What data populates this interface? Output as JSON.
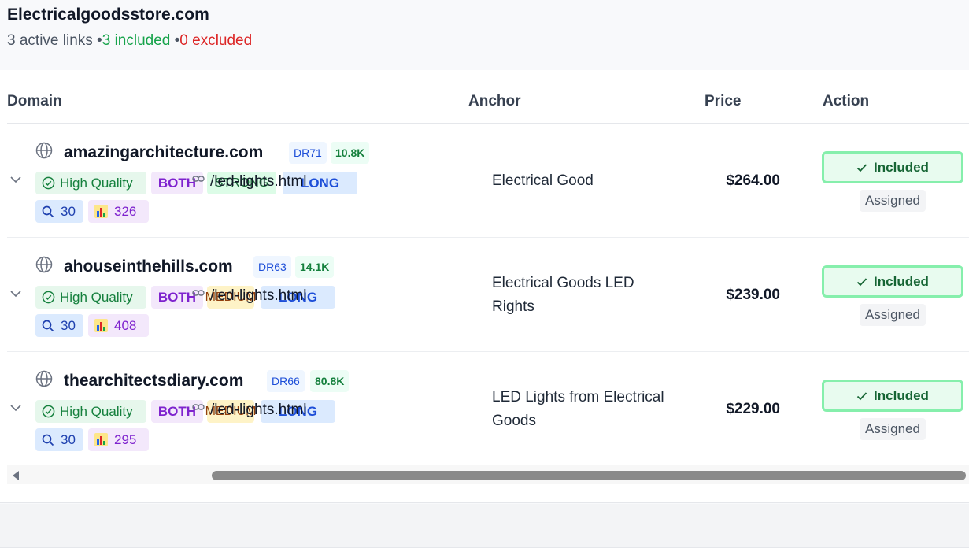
{
  "site": {
    "title": "Electricalgoodsstore.com",
    "active_links": "3 active links",
    "sep1": " •",
    "included": "3 included",
    "sep2": " •",
    "excluded": "0 excluded"
  },
  "table": {
    "headers": {
      "domain": "Domain",
      "anchor": "Anchor",
      "price": "Price",
      "action": "Action"
    }
  },
  "rows": [
    {
      "domain": "amazingarchitecture.com",
      "dr": "DR71",
      "traffic": "10.8K",
      "quality": "High Quality",
      "placement": "BOTH",
      "type": "STRONG",
      "length": "LONG",
      "url": "/led-lights.html",
      "searches": "30",
      "metric": "326",
      "anchor": "Electrical Good",
      "price": "$264.00",
      "action": "Included",
      "status": "Assigned"
    },
    {
      "domain": "ahouseinthehills.com",
      "dr": "DR63",
      "traffic": "14.1K",
      "quality": "High Quality",
      "placement": "BOTH",
      "type": "MEDIUM",
      "length": "LONG",
      "url": "/led-lights.html",
      "searches": "30",
      "metric": "408",
      "anchor": "Electrical Goods LED Rights",
      "price": "$239.00",
      "action": "Included",
      "status": "Assigned"
    },
    {
      "domain": "thearchitectsdiary.com",
      "dr": "DR66",
      "traffic": "80.8K",
      "quality": "High Quality",
      "placement": "BOTH",
      "type": "MEDIUM",
      "length": "LONG",
      "url": "/led-lights.html",
      "searches": "30",
      "metric": "295",
      "anchor": "LED Lights from Electrical Goods",
      "price": "$229.00",
      "action": "Included",
      "status": "Assigned"
    }
  ],
  "colors": {
    "included_green": "#16a34a",
    "excluded_red": "#dc2626",
    "button_border": "#86efac"
  }
}
